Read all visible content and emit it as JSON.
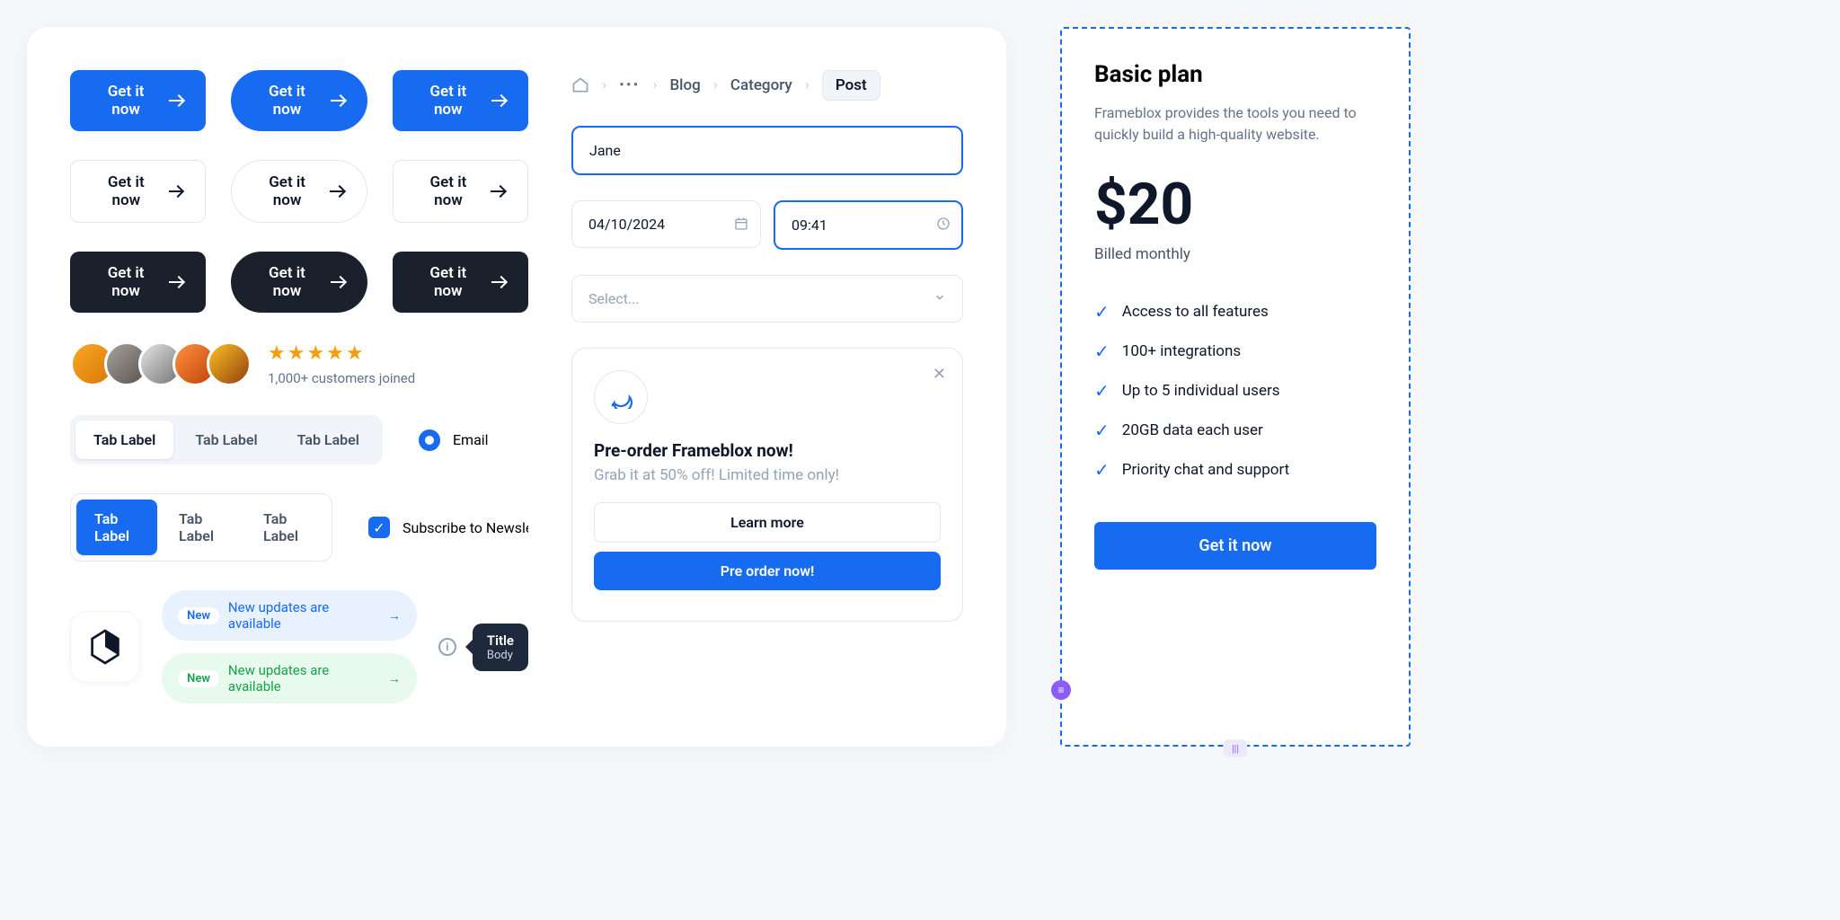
{
  "buttons": {
    "cta": "Get it now"
  },
  "breadcrumb": {
    "blog": "Blog",
    "category": "Category",
    "post": "Post"
  },
  "inputs": {
    "name": "Jane",
    "date": "04/10/2024",
    "time": "09:41",
    "select_placeholder": "Select..."
  },
  "avatars": {
    "caption": "1,000+ customers joined"
  },
  "tabs": {
    "label": "Tab Label"
  },
  "radio": {
    "label": "Email"
  },
  "checkbox": {
    "label": "Subscribe to Newsletter"
  },
  "pills": {
    "badge": "New",
    "text": "New updates are available"
  },
  "tooltip": {
    "title": "Title",
    "body": "Body"
  },
  "promo": {
    "title": "Pre-order Frameblox now!",
    "subtitle": "Grab it at 50% off! Limited time only!",
    "learn": "Learn more",
    "order": "Pre order now!"
  },
  "pricing": {
    "title": "Basic plan",
    "desc": "Frameblox provides the tools you need to quickly build a high-quality website.",
    "price": "$20",
    "billed": "Billed monthly",
    "features": [
      "Access to all features",
      "100+ integrations",
      "Up to 5 individual users",
      "20GB data each user",
      "Priority chat and support"
    ],
    "cta": "Get it now"
  }
}
